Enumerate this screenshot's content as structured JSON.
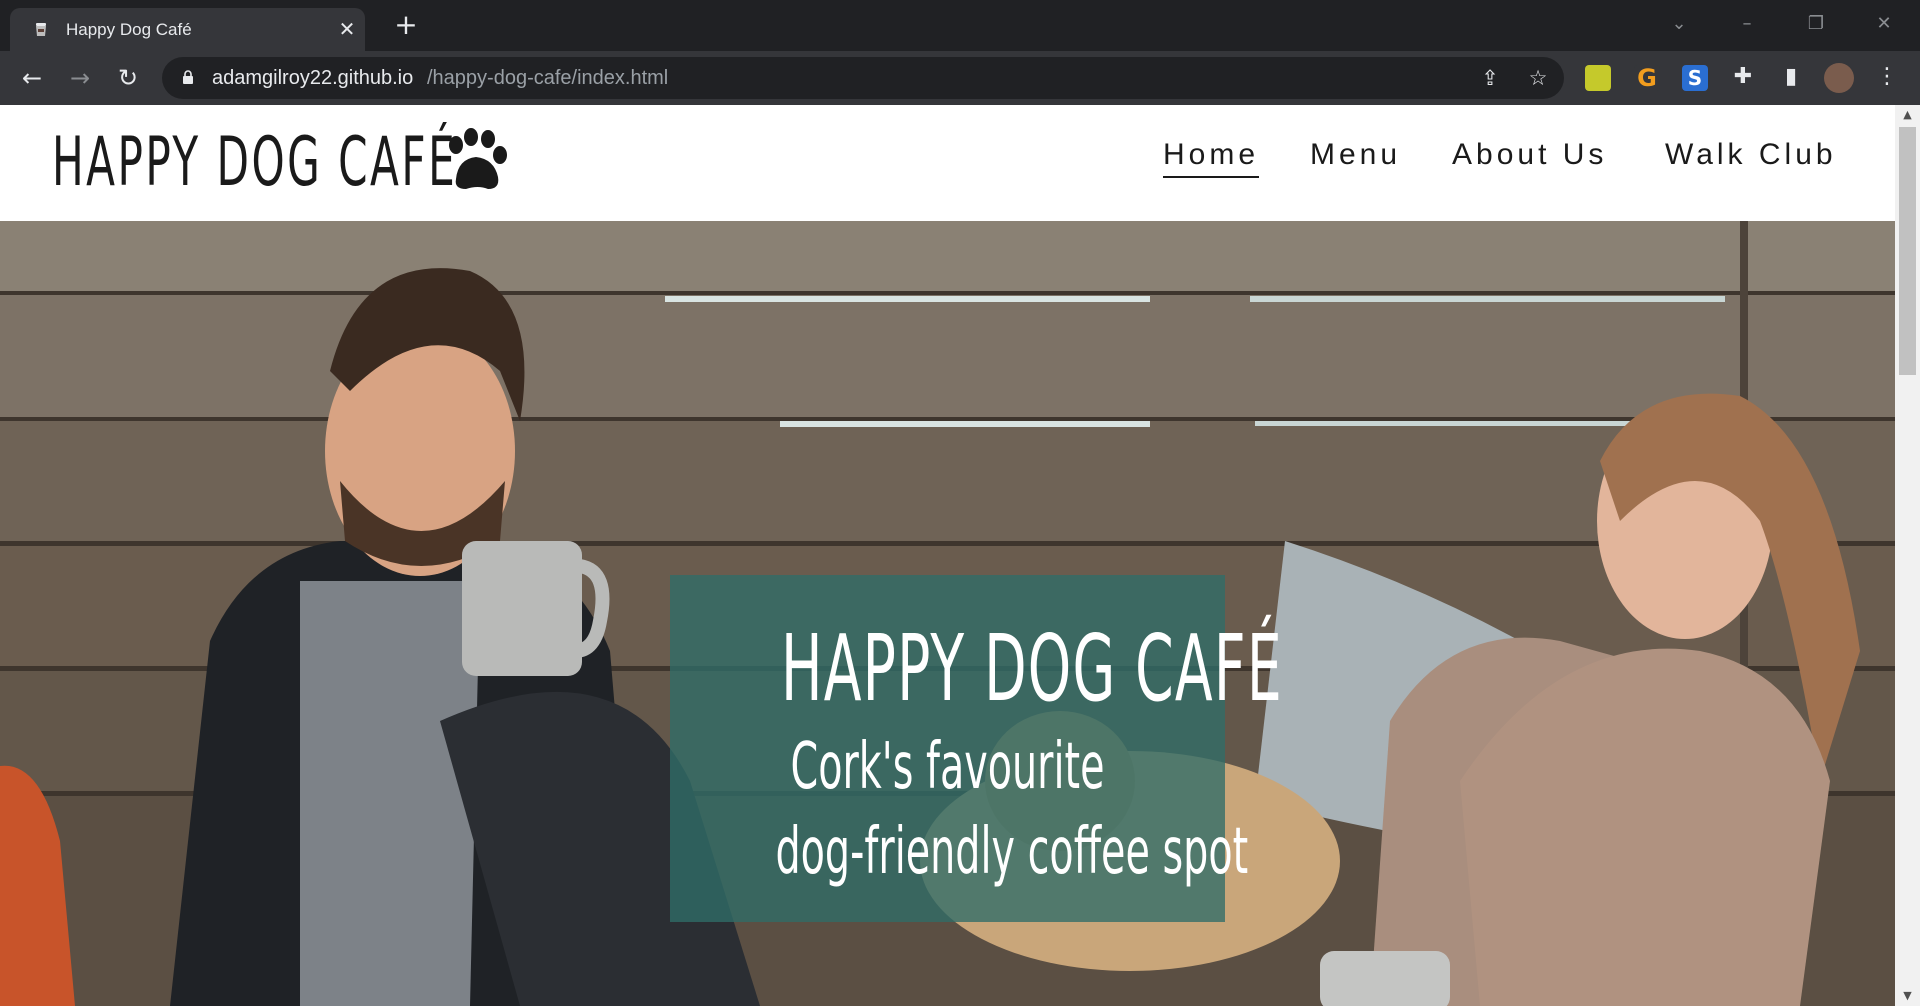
{
  "browser": {
    "tab_title": "Happy Dog Café",
    "url_host": "adamgilroy22.github.io",
    "url_path": "/happy-dog-cafe/index.html"
  },
  "site": {
    "logo": "HAPPY DOG CAFÉ",
    "nav": [
      "Home",
      "Menu",
      "About Us",
      "Walk Club"
    ],
    "active_nav": "Home"
  },
  "hero": {
    "title": "HAPPY DOG CAFÉ",
    "line1": "Cork's favourite",
    "line2": "dog-friendly coffee spot",
    "overlay_color": "#2f6d68"
  },
  "colors": {
    "chrome_dark": "#202124",
    "chrome_toolbar": "#35363a",
    "text_dark": "#1a1a1a"
  }
}
